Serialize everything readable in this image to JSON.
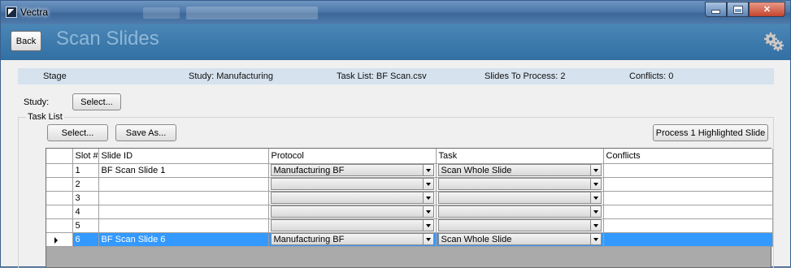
{
  "window": {
    "title": "Vectra"
  },
  "header": {
    "back_label": "Back",
    "page_title": "Scan Slides"
  },
  "infobar": {
    "stage": "Stage",
    "study": "Study: Manufacturing",
    "task_list": "Task List: BF Scan.csv",
    "slides_to_process": "Slides To Process: 2",
    "conflicts": "Conflicts: 0"
  },
  "study": {
    "label": "Study:",
    "select_label": "Select..."
  },
  "task_list": {
    "label": "Task List",
    "select_label": "Select...",
    "save_as_label": "Save As...",
    "process_label": "Process 1 Highlighted Slide"
  },
  "grid": {
    "columns": [
      "Slot #",
      "Slide ID",
      "Protocol",
      "Task",
      "Conflicts"
    ],
    "rows": [
      {
        "slot": "1",
        "slide_id": "BF Scan Slide 1",
        "protocol": "Manufacturing BF",
        "task": "Scan Whole Slide",
        "conflicts": ""
      },
      {
        "slot": "2",
        "slide_id": "",
        "protocol": "",
        "task": "",
        "conflicts": ""
      },
      {
        "slot": "3",
        "slide_id": "",
        "protocol": "",
        "task": "",
        "conflicts": ""
      },
      {
        "slot": "4",
        "slide_id": "",
        "protocol": "",
        "task": "",
        "conflicts": ""
      },
      {
        "slot": "5",
        "slide_id": "",
        "protocol": "",
        "task": "",
        "conflicts": ""
      },
      {
        "slot": "6",
        "slide_id": "BF Scan Slide 6",
        "protocol": "Manufacturing BF",
        "task": "Scan Whole Slide",
        "conflicts": ""
      }
    ],
    "selected_row": 5
  },
  "colors": {
    "header_blue": "#3a78aa",
    "selection": "#3399ff",
    "infobar": "#d6e2ee"
  }
}
